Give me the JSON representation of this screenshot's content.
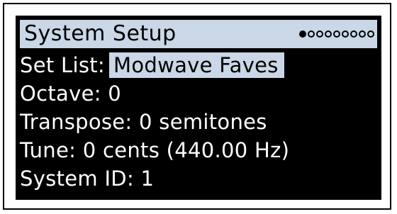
{
  "screen": {
    "title": "System Setup",
    "page_indicator": {
      "total_pages": 9,
      "current_page": 1
    },
    "setlist": {
      "label": "Set List:",
      "value": "Modwave Faves"
    },
    "rows": [
      "Octave: 0",
      "Transpose: 0 semitones",
      "Tune: 0 cents (440.00 Hz)",
      "System ID: 1"
    ]
  },
  "colors": {
    "display_background": "#000000",
    "highlight": "#c9d7e6",
    "text": "#ffffff"
  }
}
